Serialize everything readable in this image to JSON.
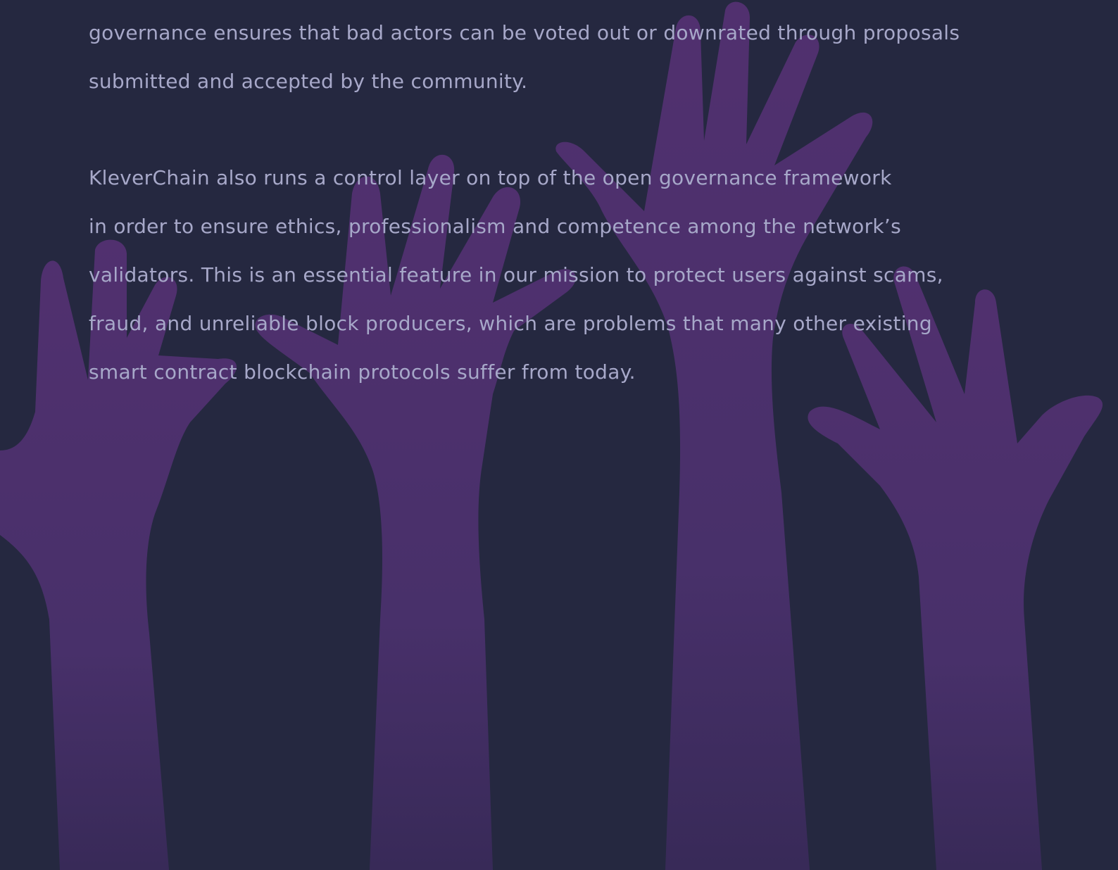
{
  "paragraphs": [
    {
      "lines": [
        "governance ensures that bad actors can be voted out or downrated through proposals",
        "submitted and accepted by the community."
      ]
    },
    {
      "lines": [
        "KleverChain also runs a control layer on top of the open governance framework",
        "in order to ensure ethics, professionalism and competence among the network’s",
        "validators. This is an essential feature in our mission to protect users against scams,",
        "fraud, and unreliable block producers, which are problems that many other existing",
        "smart contract blockchain protocols suffer from today."
      ]
    }
  ],
  "background": {
    "image": "raised-hands-illustration",
    "base_color": "#252840",
    "hand_color": "#4a2d6e"
  }
}
